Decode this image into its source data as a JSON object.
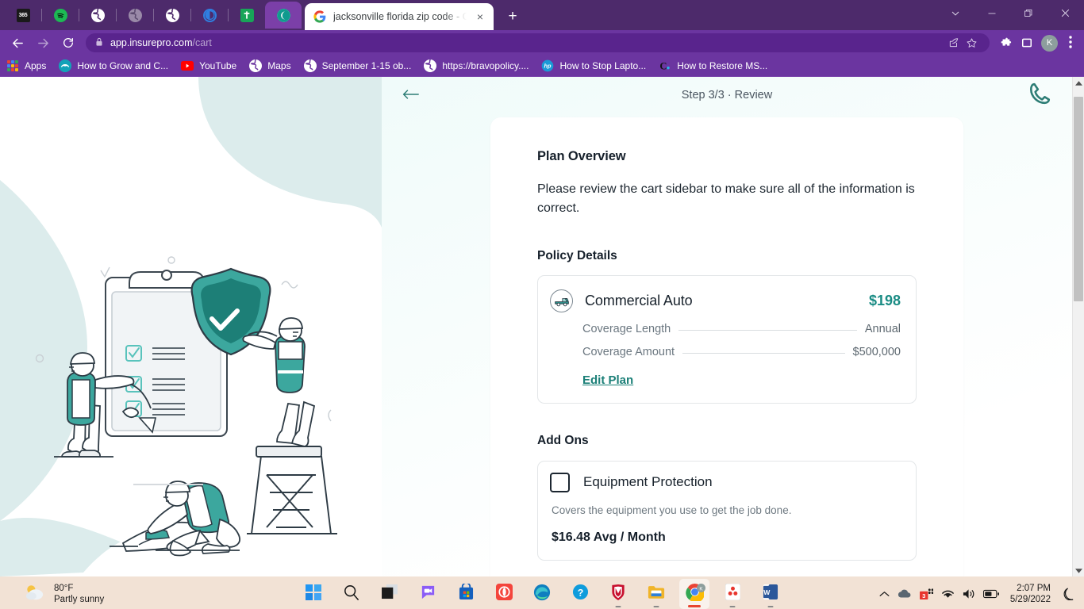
{
  "browser": {
    "pinned_tabs": [
      {
        "name": "office-365",
        "label": "365"
      },
      {
        "name": "spotify",
        "label": ""
      },
      {
        "name": "globe-1",
        "label": ""
      },
      {
        "name": "globe-2-dim",
        "label": ""
      },
      {
        "name": "globe-3",
        "label": ""
      },
      {
        "name": "ring",
        "label": ""
      },
      {
        "name": "google-sheets",
        "label": ""
      },
      {
        "name": "insurepro-active",
        "label": ""
      }
    ],
    "active_tab": {
      "title": "jacksonville florida zip code - Go",
      "favicon": "google-icon",
      "close_label": "×"
    },
    "new_tab_label": "+",
    "window_controls": {
      "tab_search": "⌄",
      "minimize": "—",
      "maximize": "❐",
      "close": "✕"
    },
    "nav": {
      "back": "←",
      "forward": "→",
      "reload": "↻"
    },
    "omnibox": {
      "lock_icon": "lock-icon",
      "host": "app.insurepro.com",
      "path": "/cart",
      "share_icon": "share-icon",
      "bookmark_icon": "star-icon"
    },
    "toolbar": {
      "extensions_icon": "puzzle-icon",
      "sidepanel_icon": "sidepanel-icon",
      "profile_initial": "K",
      "menu_icon": "kebab-menu-icon"
    },
    "bookmarks": [
      {
        "label": "Apps",
        "icon": "apps-grid-icon"
      },
      {
        "label": "How to Grow and C...",
        "icon": "teal-circle-icon"
      },
      {
        "label": "YouTube",
        "icon": "youtube-icon"
      },
      {
        "label": "Maps",
        "icon": "globe-icon"
      },
      {
        "label": "September 1-15 ob...",
        "icon": "globe-icon"
      },
      {
        "label": "https://bravopolicy....",
        "icon": "globe-icon"
      },
      {
        "label": "How to Stop Lapto...",
        "icon": "hp-icon"
      },
      {
        "label": "How to Restore MS...",
        "icon": "c-icon"
      }
    ]
  },
  "page": {
    "header": {
      "back_arrow": "←",
      "step_label": "Step 3/3 · Review",
      "phone_icon": "phone-icon"
    },
    "plan_overview": {
      "heading": "Plan Overview",
      "body": "Please review the cart sidebar to make sure all of the information is correct."
    },
    "policy_details": {
      "heading": "Policy Details",
      "plan_name": "Commercial Auto",
      "plan_icon": "commercial-auto-icon",
      "price": "$198",
      "rows": [
        {
          "label": "Coverage Length",
          "value": "Annual"
        },
        {
          "label": "Coverage Amount",
          "value": "$500,000"
        }
      ],
      "edit_link": "Edit Plan"
    },
    "add_ons": {
      "heading": "Add Ons",
      "items": [
        {
          "name": "Equipment Protection",
          "description": "Covers the equipment you use to get the job done.",
          "price": "$16.48 Avg / Month",
          "checked": false
        }
      ]
    }
  },
  "taskbar": {
    "weather": {
      "temperature": "80°F",
      "condition": "Partly sunny",
      "icon": "partly-sunny-icon"
    },
    "apps": [
      {
        "name": "start-button",
        "icon": "windows-logo-icon"
      },
      {
        "name": "search-button",
        "icon": "search-icon"
      },
      {
        "name": "task-view-button",
        "icon": "task-view-icon"
      },
      {
        "name": "chat-button",
        "icon": "chat-icon"
      },
      {
        "name": "microsoft-store",
        "icon": "store-icon"
      },
      {
        "name": "app-red",
        "icon": "red-app-icon"
      },
      {
        "name": "microsoft-edge",
        "icon": "edge-icon"
      },
      {
        "name": "help-support",
        "icon": "question-icon"
      },
      {
        "name": "mcafee",
        "icon": "shield-icon"
      },
      {
        "name": "file-explorer",
        "icon": "folder-icon"
      },
      {
        "name": "google-chrome",
        "icon": "chrome-icon"
      },
      {
        "name": "solitaire",
        "icon": "solitaire-icon"
      },
      {
        "name": "microsoft-word",
        "icon": "word-icon"
      }
    ],
    "tray": {
      "chevron": "⌃",
      "onedrive_icon": "cloud-icon",
      "updates_icon": "updates-icon",
      "wifi_icon": "wifi-icon",
      "volume_icon": "volume-icon",
      "battery_icon": "battery-icon",
      "time": "2:07 PM",
      "date": "5/29/2022",
      "notification_icon": "moon-icon"
    }
  },
  "colors": {
    "browser_chrome": "#6b35a0",
    "tabstrip": "#4d2a6b",
    "accent_teal": "#1a8c84",
    "taskbar": "#f2e2d5"
  }
}
